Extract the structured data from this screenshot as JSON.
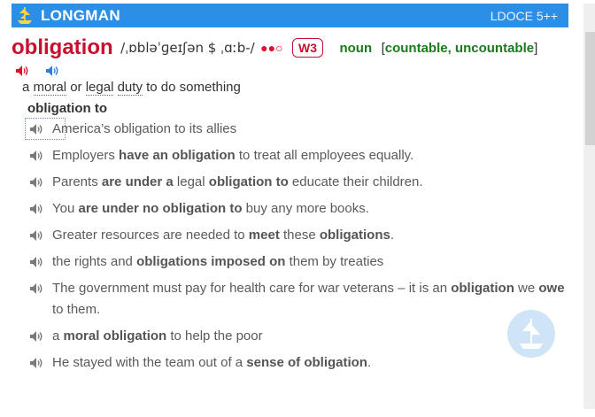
{
  "header": {
    "brand": "LONGMAN",
    "edition": "LDOCE 5++"
  },
  "entry": {
    "headword": "obligation",
    "pronunciation": "/ˌɒbləˈɡeɪʃən $ ˌɑːb-/",
    "frequency_dots": "●●",
    "frequency_empty": "○",
    "frequency_badge": "W3",
    "part_of_speech": "noun",
    "grammar": "countable, uncountable"
  },
  "definition": {
    "pre": "a",
    "word1": "moral",
    "mid1": "or",
    "word2": "legal",
    "word3": "duty",
    "post": "to do something"
  },
  "collocation": "obligation to",
  "examples": [
    {
      "parts": [
        {
          "t": "America’s obligation to its allies",
          "b": false
        }
      ]
    },
    {
      "parts": [
        {
          "t": "Employers ",
          "b": false
        },
        {
          "t": "have an obligation",
          "b": true
        },
        {
          "t": " to treat all employees equally.",
          "b": false
        }
      ]
    },
    {
      "parts": [
        {
          "t": "Parents ",
          "b": false
        },
        {
          "t": "are under a",
          "b": true
        },
        {
          "t": " legal ",
          "b": false
        },
        {
          "t": "obligation to",
          "b": true
        },
        {
          "t": " educate their children.",
          "b": false
        }
      ]
    },
    {
      "parts": [
        {
          "t": "You ",
          "b": false
        },
        {
          "t": "are under no obligation to",
          "b": true
        },
        {
          "t": " buy any more books.",
          "b": false
        }
      ]
    },
    {
      "parts": [
        {
          "t": "Greater resources are needed to ",
          "b": false
        },
        {
          "t": "meet",
          "b": true
        },
        {
          "t": " these ",
          "b": false
        },
        {
          "t": "obligations",
          "b": true
        },
        {
          "t": ".",
          "b": false
        }
      ]
    },
    {
      "parts": [
        {
          "t": "the rights and ",
          "b": false
        },
        {
          "t": "obligations imposed on",
          "b": true
        },
        {
          "t": " them by treaties",
          "b": false
        }
      ]
    },
    {
      "parts": [
        {
          "t": "The government must pay for health care for war veterans – it is an ",
          "b": false
        },
        {
          "t": "obligation",
          "b": true
        },
        {
          "t": " we ",
          "b": false
        },
        {
          "t": "owe",
          "b": true
        },
        {
          "t": " to them.",
          "b": false
        }
      ]
    },
    {
      "parts": [
        {
          "t": "a ",
          "b": false
        },
        {
          "t": "moral obligation",
          "b": true
        },
        {
          "t": " to help the poor",
          "b": false
        }
      ]
    },
    {
      "parts": [
        {
          "t": "He stayed with the team out of a ",
          "b": false
        },
        {
          "t": "sense of obligation",
          "b": true
        },
        {
          "t": ".",
          "b": false
        }
      ]
    }
  ],
  "colors": {
    "header_blue": "#2d8ee6",
    "headword_red": "#c8102e",
    "pos_green": "#1c7a1c"
  },
  "icons": {
    "logo": "ship-logo-icon",
    "speaker_uk": "speaker-red-icon",
    "speaker_us": "speaker-blue-icon",
    "example_audio": "speaker-gray-icon"
  }
}
